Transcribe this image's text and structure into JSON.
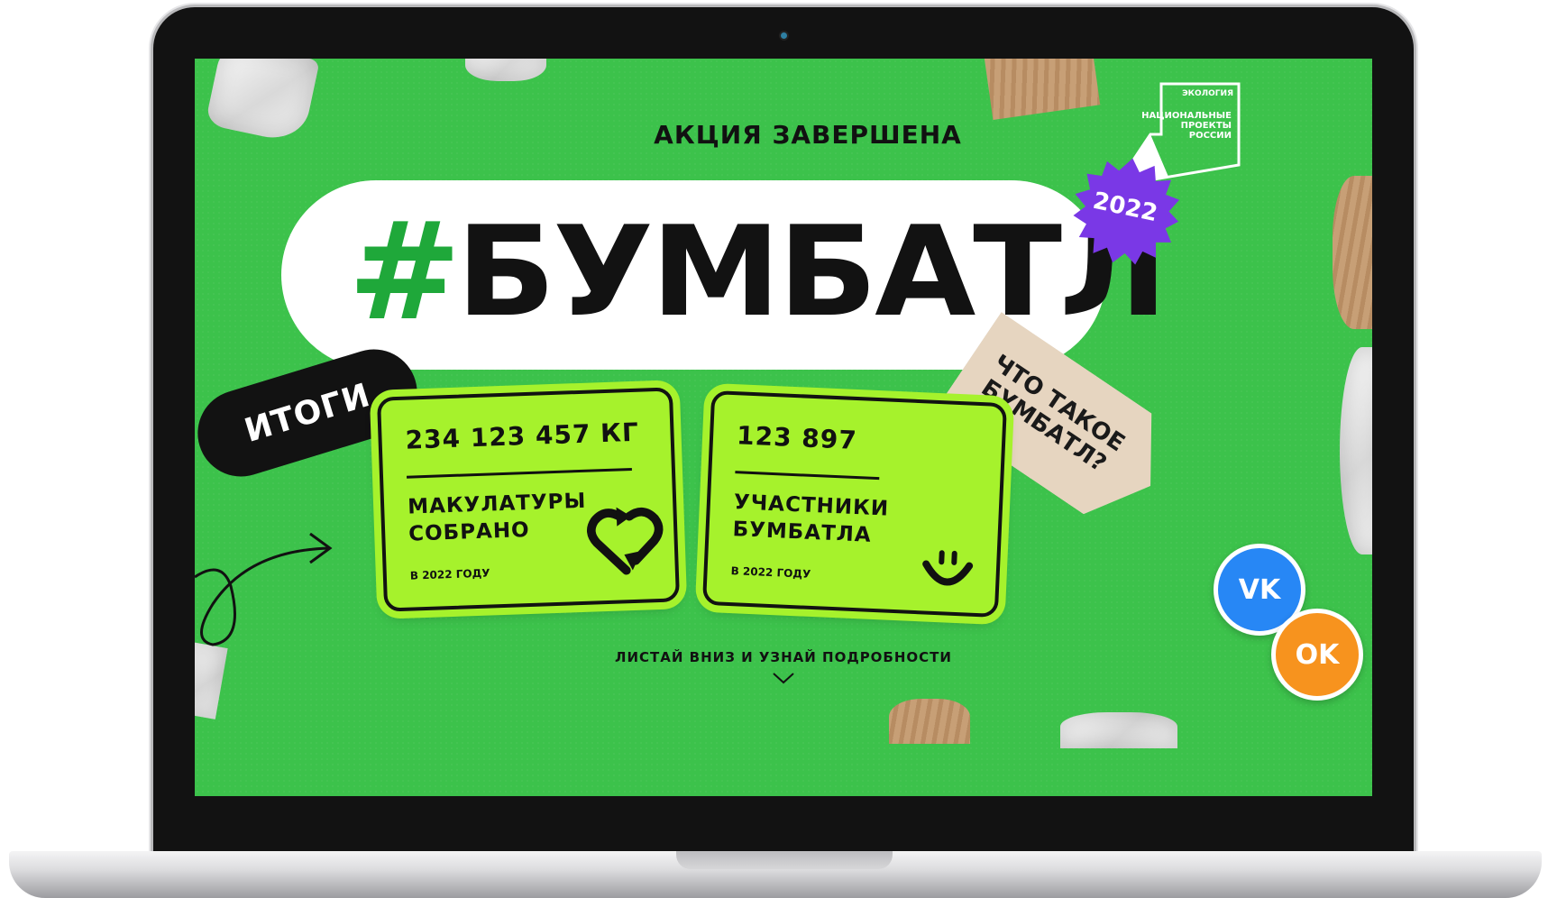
{
  "promo": {
    "status_headline": "АКЦИЯ ЗАВЕРШЕНА",
    "title_hash": "#",
    "title_word": "БУМБАТЛ",
    "year_badge": "2022",
    "results_label": "ИТОГИ",
    "what_is_label": "ЧТО ТАКОЕ БУМБАТЛ?",
    "scroll_hint": "ЛИСТАЙ ВНИЗ И УЗНАЙ ПОДРОБНОСТИ"
  },
  "partner_logo": {
    "category": "ЭКОЛОГИЯ",
    "name": "НАЦИОНАЛЬНЫЕ ПРОЕКТЫ РОССИИ"
  },
  "stats": [
    {
      "value": "234 123 457 КГ",
      "label": "МАКУЛАТУРЫ СОБРАНО",
      "period": "В 2022 ГОДУ",
      "icon": "recycle-heart-icon"
    },
    {
      "value": "123 897",
      "label": "УЧАСТНИКИ БУМБАТЛА",
      "period": "В 2022 ГОДУ",
      "icon": "smile-icon"
    }
  ],
  "social": {
    "vk_label": "VK",
    "ok_label": "OK"
  },
  "colors": {
    "background_green": "#3cc24b",
    "card_lime": "#a6f22c",
    "hash_green": "#1fa83a",
    "badge_purple": "#7a38e6",
    "vk_blue": "#2787f5",
    "ok_orange": "#f7931e",
    "ink": "#121212"
  }
}
